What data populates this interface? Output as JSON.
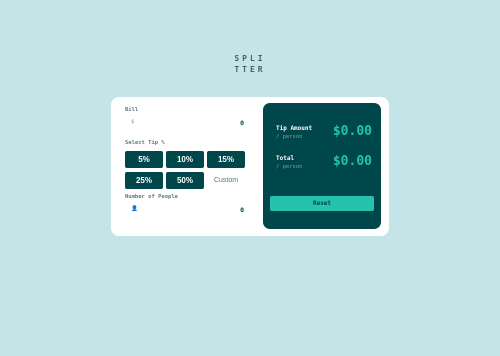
{
  "app": {
    "logo_line1": "SPLI",
    "logo_line2": "TTER"
  },
  "bill": {
    "label": "Bill",
    "icon": "dollar-icon",
    "icon_glyph": "$",
    "value": "0"
  },
  "tip": {
    "label": "Select Tip %",
    "options": [
      "5%",
      "10%",
      "15%",
      "25%",
      "50%"
    ],
    "custom_label": "Custom"
  },
  "people": {
    "label": "Number of People",
    "icon": "person-icon",
    "icon_glyph": "👤",
    "value": "0"
  },
  "summary": {
    "tip_amount_label": "Tip Amount",
    "tip_amount_sub": "/ person",
    "tip_amount_value": "$0.00",
    "total_label": "Total",
    "total_sub": "/ person",
    "total_value": "$0.00",
    "reset_label": "Reset"
  },
  "colors": {
    "background": "#c5e4e7",
    "card": "#ffffff",
    "dark_teal": "#00474b",
    "accent": "#26c2ad"
  }
}
